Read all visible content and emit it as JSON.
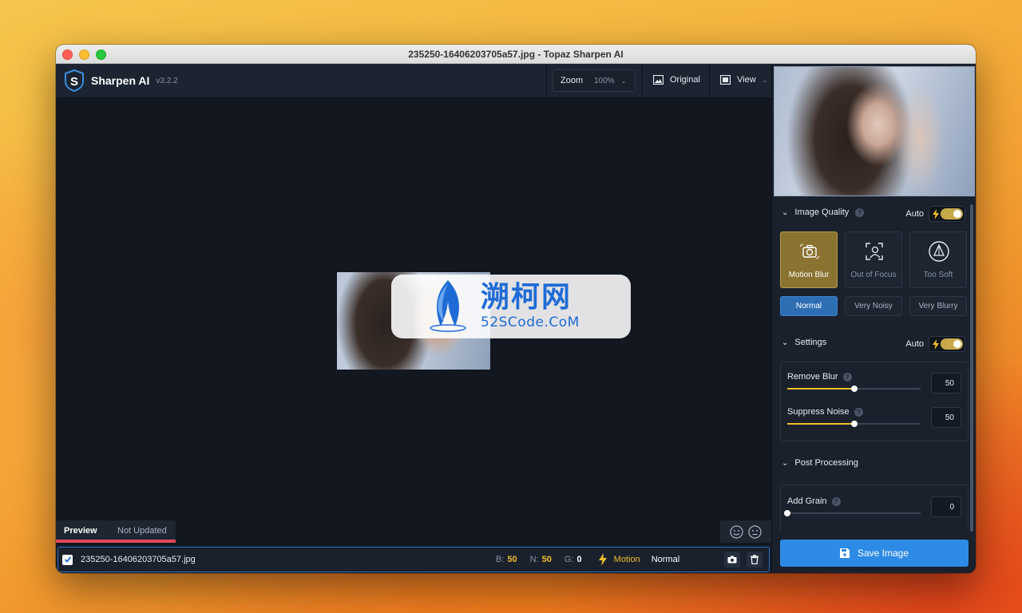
{
  "window": {
    "title": "235250-16406203705a57.jpg - Topaz Sharpen AI"
  },
  "toolbar": {
    "app_name": "Sharpen AI",
    "version": "v3.2.2",
    "zoom_label": "Zoom",
    "zoom_value": "100%",
    "original_label": "Original",
    "view_label": "View"
  },
  "watermark": {
    "title": "溯柯网",
    "subtitle": "52SCode.CoM"
  },
  "preview_tabs": {
    "preview": "Preview",
    "status": "Not Updated"
  },
  "file_row": {
    "checked": true,
    "file_name": "235250-16406203705a57.jpg",
    "b_label": "B:",
    "b_value": "50",
    "n_label": "N:",
    "n_value": "50",
    "g_label": "G:",
    "g_value": "0",
    "mode": "Motion",
    "noise": "Normal"
  },
  "image_quality": {
    "title": "Image Quality",
    "auto_label": "Auto",
    "auto_on": true,
    "modes": [
      {
        "label": "Motion Blur",
        "active": true
      },
      {
        "label": "Out of Focus",
        "active": false
      },
      {
        "label": "Too Soft",
        "active": false
      }
    ],
    "noise_levels": [
      {
        "label": "Normal",
        "active": true
      },
      {
        "label": "Very Noisy",
        "active": false
      },
      {
        "label": "Very Blurry",
        "active": false
      }
    ]
  },
  "settings": {
    "title": "Settings",
    "auto_label": "Auto",
    "auto_on": true,
    "remove_blur": {
      "label": "Remove Blur",
      "value": "50",
      "fraction": 0.5
    },
    "suppress_noise": {
      "label": "Suppress Noise",
      "value": "50",
      "fraction": 0.5
    }
  },
  "post_processing": {
    "title": "Post Processing",
    "add_grain": {
      "label": "Add Grain",
      "value": "0",
      "fraction": 0
    }
  },
  "save_button": {
    "label": "Save Image"
  },
  "colors": {
    "accent_gold": "#f0bd2a",
    "accent_blue": "#2d8be6",
    "active_mode": "#8a7230",
    "preview_underline": "#e2495a"
  }
}
